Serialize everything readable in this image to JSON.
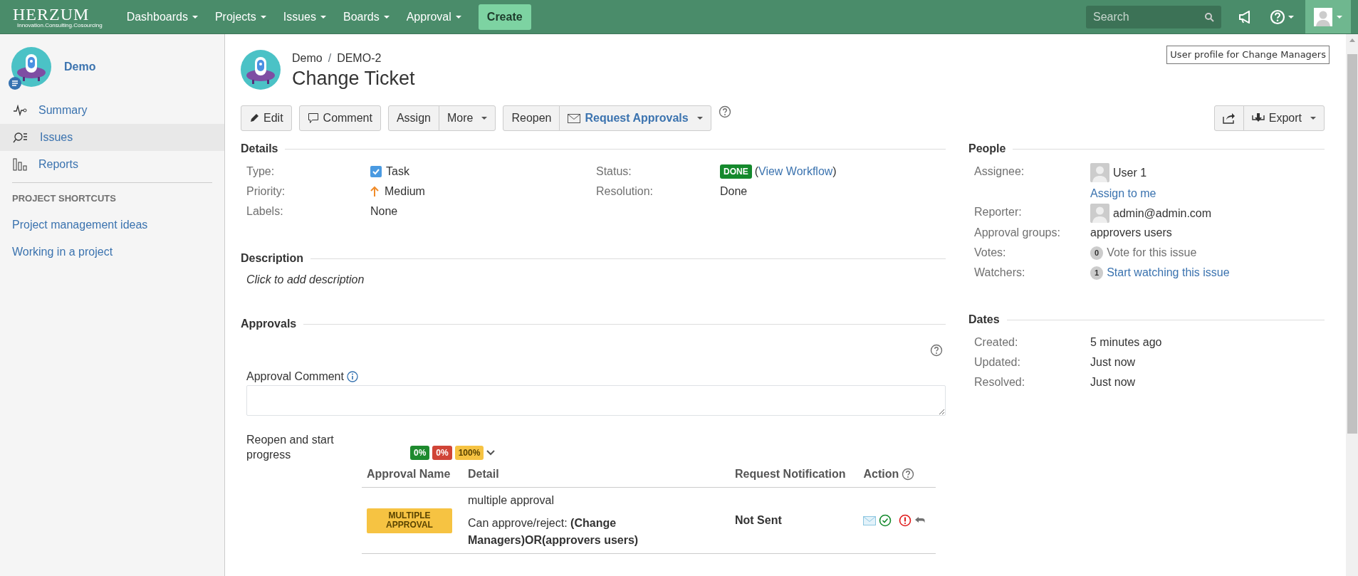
{
  "header": {
    "logo": "HERZUM",
    "tagline": "Innovation.Consulting.Cosourcing",
    "menus": [
      {
        "label": "Dashboards"
      },
      {
        "label": "Projects"
      },
      {
        "label": "Issues"
      },
      {
        "label": "Boards"
      },
      {
        "label": "Approval"
      }
    ],
    "create": "Create",
    "search": {
      "placeholder": "Search"
    },
    "tooltip": "User profile for Change Managers"
  },
  "sidebar": {
    "project": "Demo",
    "items": [
      {
        "label": "Summary",
        "selected": false
      },
      {
        "label": "Issues",
        "selected": true
      },
      {
        "label": "Reports",
        "selected": false
      }
    ],
    "shortcuts_heading": "PROJECT SHORTCUTS",
    "shortcuts": [
      "Project management ideas",
      "Working in a project"
    ]
  },
  "issue": {
    "breadcrumb": [
      "Demo",
      "DEMO-2"
    ],
    "separator": "/",
    "title": "Change Ticket"
  },
  "toolbar": {
    "groups": [
      [
        {
          "label": "Edit",
          "kind": "edit"
        }
      ],
      [
        {
          "label": "Comment",
          "kind": "comment"
        }
      ],
      [
        {
          "label": "Assign",
          "kind": "plain"
        },
        {
          "label": "More",
          "kind": "menu"
        }
      ],
      [
        {
          "label": "Reopen",
          "kind": "plain"
        },
        {
          "label": "Request Approvals",
          "kind": "request"
        }
      ]
    ],
    "right_groups": [
      [
        {
          "kind": "share"
        },
        {
          "label": "Export",
          "kind": "export"
        }
      ]
    ]
  },
  "details": {
    "heading": "Details",
    "left": [
      {
        "label": "Type:",
        "kind": "type",
        "value": "Task"
      },
      {
        "label": "Priority:",
        "kind": "priority",
        "value": "Medium"
      },
      {
        "label": "Labels:",
        "kind": "text",
        "value": "None"
      }
    ],
    "right": [
      {
        "label": "Status:",
        "kind": "status",
        "lozenge": "DONE",
        "open": "(",
        "link": "View Workflow",
        "close": ")"
      },
      {
        "label": "Resolution:",
        "kind": "text",
        "value": "Done"
      }
    ]
  },
  "description": {
    "heading": "Description",
    "placeholder": "Click to add description"
  },
  "approvals": {
    "heading": "Approvals",
    "comment_label": "Approval Comment",
    "stage": "Reopen and start progress",
    "progress": [
      {
        "label": "0%",
        "color": "#1e8a2e"
      },
      {
        "label": "0%",
        "color": "#d04437"
      },
      {
        "label": "100%",
        "color": "#f6c342"
      }
    ],
    "columns": [
      "Approval Name",
      "Detail",
      "Request Notification",
      "Action"
    ],
    "rows": [
      {
        "name": "MULTIPLE APPROVAL",
        "detail": "multiple approval",
        "who": "Can approve/reject: **(Change Managers)OR(approvers users)**",
        "notification": "Not Sent"
      }
    ]
  },
  "people": {
    "heading": "People",
    "fields": [
      {
        "label": "Assignee:",
        "kind": "user",
        "value": "User 1",
        "action": "Assign to me"
      },
      {
        "label": "Reporter:",
        "kind": "user",
        "value": "admin@admin.com"
      },
      {
        "label": "Approval groups:",
        "kind": "text",
        "value": "approvers users"
      },
      {
        "label": "Votes:",
        "kind": "count",
        "count": "0",
        "value": "Vote for this issue",
        "disabled": true
      },
      {
        "label": "Watchers:",
        "kind": "count",
        "count": "1",
        "value": "Start watching this issue",
        "disabled": false
      }
    ]
  },
  "dates": {
    "heading": "Dates",
    "fields": [
      {
        "label": "Created:",
        "value": "5 minutes ago"
      },
      {
        "label": "Updated:",
        "value": "Just now"
      },
      {
        "label": "Resolved:",
        "value": "Just now"
      }
    ]
  }
}
